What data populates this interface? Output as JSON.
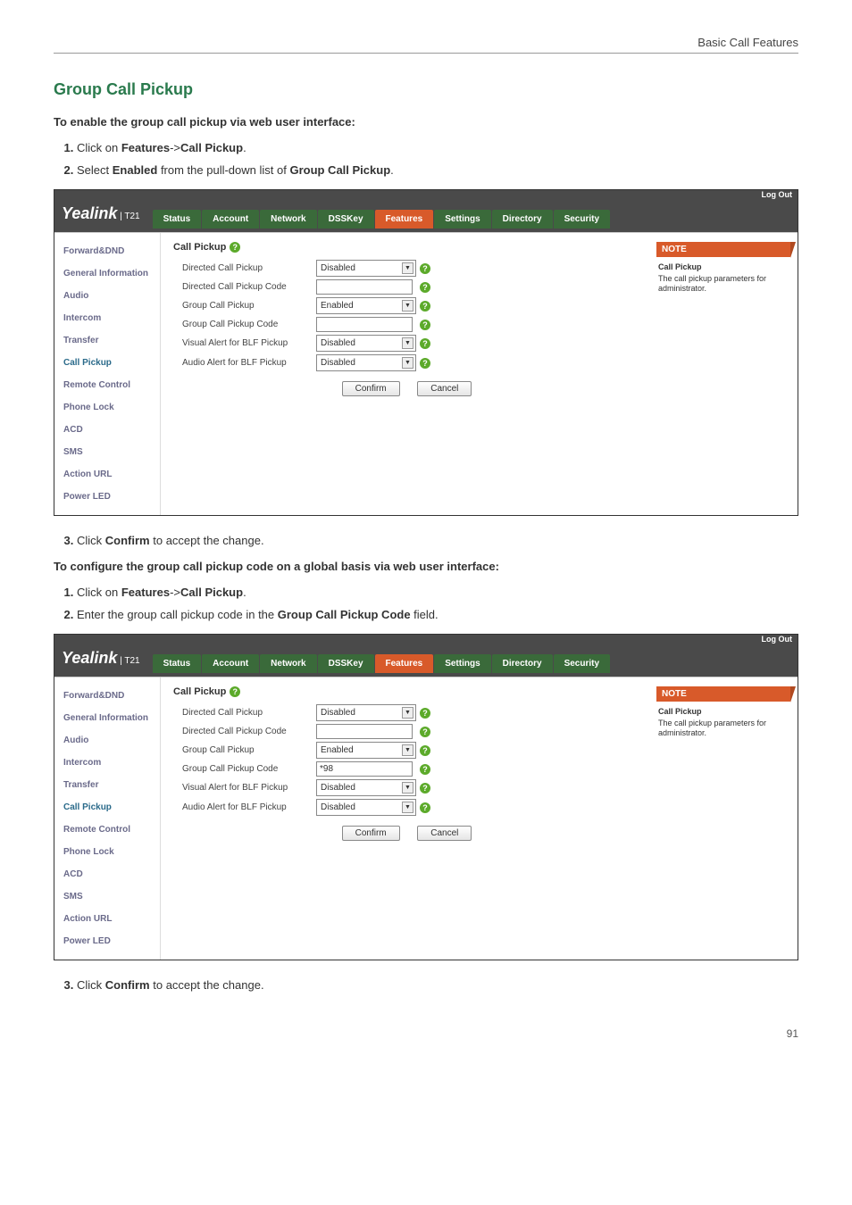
{
  "header_right": "Basic Call Features",
  "section_title": "Group Call Pickup",
  "intro1": "To enable the group call pickup via web user interface:",
  "steps1": [
    {
      "prefix": "Click on ",
      "bold1": "Features",
      "mid": "->",
      "bold2": "Call Pickup",
      "suffix": "."
    },
    {
      "prefix": "Select ",
      "bold1": "Enabled",
      "mid": " from the pull-down list of ",
      "bold2": "Group Call Pickup",
      "suffix": "."
    }
  ],
  "shot": {
    "logout": "Log Out",
    "logo": "Yealink",
    "logo_sub": "T21",
    "tabs": [
      "Status",
      "Account",
      "Network",
      "DSSKey",
      "Features",
      "Settings",
      "Directory",
      "Security"
    ],
    "active_tab_index": 4,
    "sidebar": [
      "Forward&DND",
      "General Information",
      "Audio",
      "Intercom",
      "Transfer",
      "Call Pickup",
      "Remote Control",
      "Phone Lock",
      "ACD",
      "SMS",
      "Action URL",
      "Power LED"
    ],
    "sidebar_active_index": 5,
    "center_title": "Call Pickup",
    "rows": [
      {
        "label": "Directed Call Pickup",
        "type": "select",
        "value": "Disabled"
      },
      {
        "label": "Directed Call Pickup Code",
        "type": "text",
        "value": ""
      },
      {
        "label": "Group Call Pickup",
        "type": "select",
        "value": "Enabled"
      },
      {
        "label": "Group Call Pickup Code",
        "type": "text",
        "value": ""
      },
      {
        "label": "Visual Alert for BLF Pickup",
        "type": "select",
        "value": "Disabled"
      },
      {
        "label": "Audio Alert for BLF Pickup",
        "type": "select",
        "value": "Disabled"
      }
    ],
    "confirm": "Confirm",
    "cancel": "Cancel",
    "note_hdr": "NOTE",
    "note_title": "Call Pickup",
    "note_text": "The call pickup parameters for administrator."
  },
  "after1": "Click Confirm to accept the change.",
  "after1_prefix": "Click ",
  "after1_bold": "Confirm",
  "after1_suffix": " to accept the change.",
  "intro2": "To configure the group call pickup code on a global basis via web user interface:",
  "steps2": [
    {
      "prefix": "Click on ",
      "bold1": "Features",
      "mid": "->",
      "bold2": "Call Pickup",
      "suffix": "."
    },
    {
      "prefix": "Enter the group call pickup code in the ",
      "bold1": "Group Call Pickup Code",
      "mid": "",
      "bold2": "",
      "suffix": " field."
    }
  ],
  "shot2_rows": [
    {
      "label": "Directed Call Pickup",
      "type": "select",
      "value": "Disabled"
    },
    {
      "label": "Directed Call Pickup Code",
      "type": "text",
      "value": ""
    },
    {
      "label": "Group Call Pickup",
      "type": "select",
      "value": "Enabled"
    },
    {
      "label": "Group Call Pickup Code",
      "type": "text",
      "value": "*98"
    },
    {
      "label": "Visual Alert for BLF Pickup",
      "type": "select",
      "value": "Disabled"
    },
    {
      "label": "Audio Alert for BLF Pickup",
      "type": "select",
      "value": "Disabled"
    }
  ],
  "page_num": "91"
}
